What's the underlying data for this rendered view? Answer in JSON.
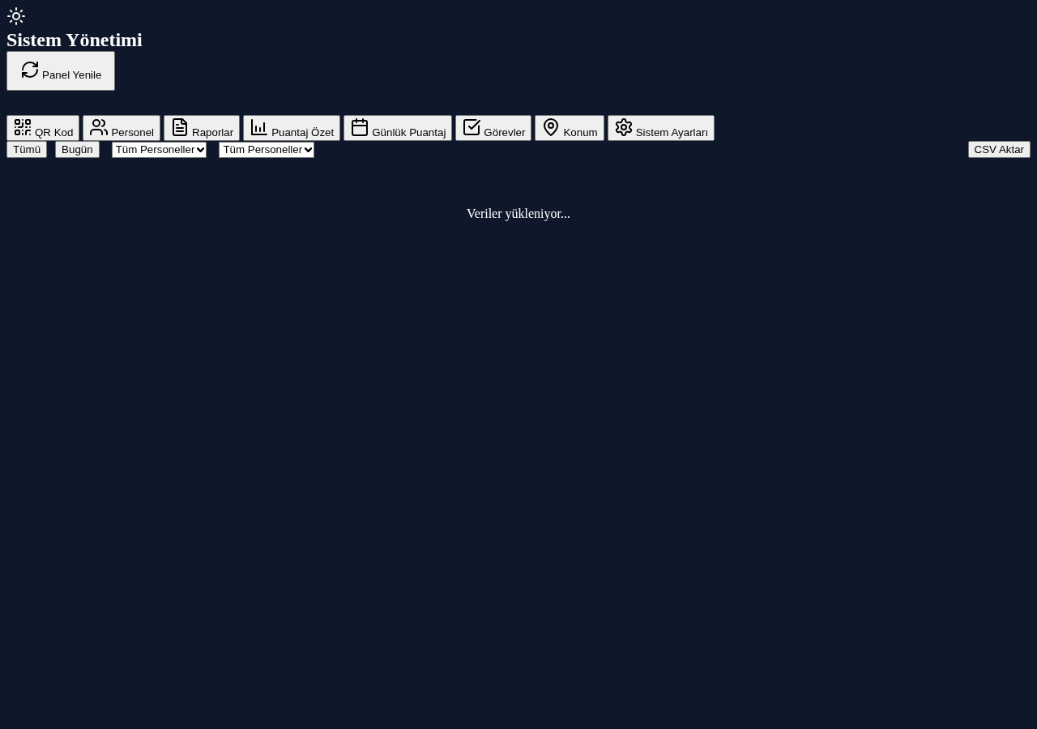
{
  "header": {
    "title": "Sistem Yönetimi",
    "refresh_button": {
      "label": "Panel Yenile"
    }
  },
  "tabs": [
    {
      "label": "QR Kod"
    },
    {
      "label": "Personel"
    },
    {
      "label": "Raporlar"
    },
    {
      "label": "Puantaj Özet"
    },
    {
      "label": "Günlük Puantaj"
    },
    {
      "label": "Görevler"
    },
    {
      "label": "Konum"
    },
    {
      "label": "Sistem Ayarları"
    }
  ],
  "filters": {
    "buttons": [
      {
        "label": "Tümü"
      },
      {
        "label": "Bugün"
      }
    ],
    "selects": [
      {
        "value": "Tüm Personeller"
      },
      {
        "value": "Tüm Personeller"
      }
    ],
    "export_button": {
      "label": "CSV Aktar"
    }
  },
  "status_message": "Veriler yükleniyor..."
}
